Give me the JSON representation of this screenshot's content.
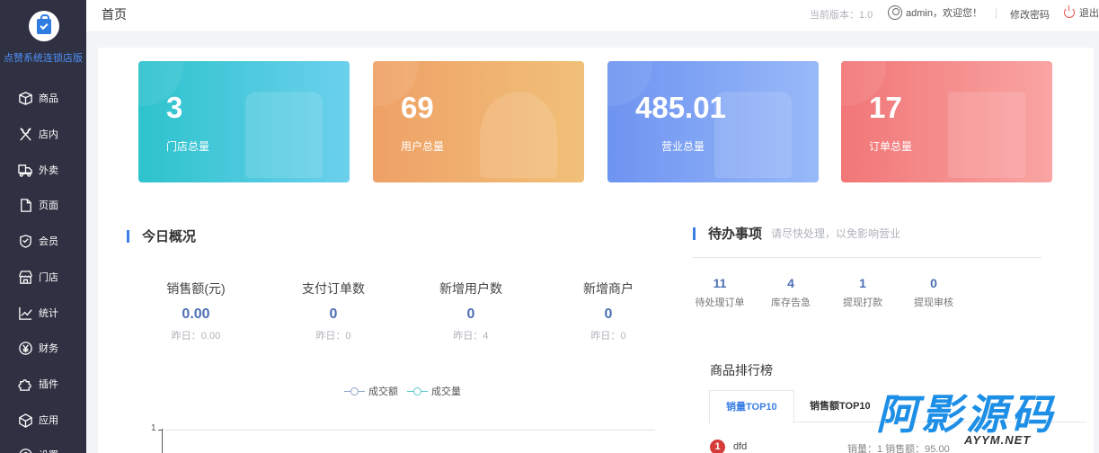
{
  "sidebar": {
    "shop_name": "点赞系统连锁店版",
    "items": [
      {
        "label": "商品",
        "icon": "box-icon"
      },
      {
        "label": "店内",
        "icon": "utensils-icon"
      },
      {
        "label": "外卖",
        "icon": "delivery-icon"
      },
      {
        "label": "页面",
        "icon": "page-icon"
      },
      {
        "label": "会员",
        "icon": "member-icon"
      },
      {
        "label": "门店",
        "icon": "store-icon"
      },
      {
        "label": "统计",
        "icon": "chart-icon"
      },
      {
        "label": "财务",
        "icon": "finance-icon"
      },
      {
        "label": "插件",
        "icon": "plugin-icon"
      },
      {
        "label": "应用",
        "icon": "app-icon"
      },
      {
        "label": "设置",
        "icon": "settings-icon"
      }
    ]
  },
  "header": {
    "title": "首页",
    "version": "当前版本：1.0",
    "welcome": "admin，欢迎您！",
    "change_password": "修改密码",
    "logout": "退出"
  },
  "cards": [
    {
      "value": "3",
      "label": "门店总量",
      "color": "#2dc3cd"
    },
    {
      "value": "69",
      "label": "用户总量",
      "color": "#efa167"
    },
    {
      "value": "485.01",
      "label": "营业总量",
      "color": "#6e94f1"
    },
    {
      "value": "17",
      "label": "订单总量",
      "color": "#f17677"
    }
  ],
  "today": {
    "title": "今日概况",
    "stats": [
      {
        "label": "销售额(元)",
        "value": "0.00",
        "yesterday": "昨日：0.00"
      },
      {
        "label": "支付订单数",
        "value": "0",
        "yesterday": "昨日：0"
      },
      {
        "label": "新增用户数",
        "value": "0",
        "yesterday": "昨日：4"
      },
      {
        "label": "新增商户",
        "value": "0",
        "yesterday": "昨日：0"
      }
    ],
    "legend": [
      {
        "name": "成交额",
        "color": "#8ea2c8"
      },
      {
        "name": "成交量",
        "color": "#5cc8c9"
      }
    ],
    "y_tick": "1"
  },
  "todo": {
    "title": "待办事项",
    "subtitle": "请尽快处理，以免影响营业",
    "items": [
      {
        "value": "11",
        "label": "待处理订单"
      },
      {
        "value": "4",
        "label": "库存告急"
      },
      {
        "value": "1",
        "label": "提现打款"
      },
      {
        "value": "0",
        "label": "提现审核"
      }
    ]
  },
  "ranking": {
    "title": "商品排行榜",
    "tabs": [
      "销量TOP10",
      "销售额TOP10"
    ],
    "rows": [
      {
        "rank": "1",
        "name": "dfd",
        "stat": "销量：1  销售额：95.00"
      }
    ]
  },
  "watermark": {
    "text": "阿影源码",
    "sub": "AYYM.NET"
  }
}
